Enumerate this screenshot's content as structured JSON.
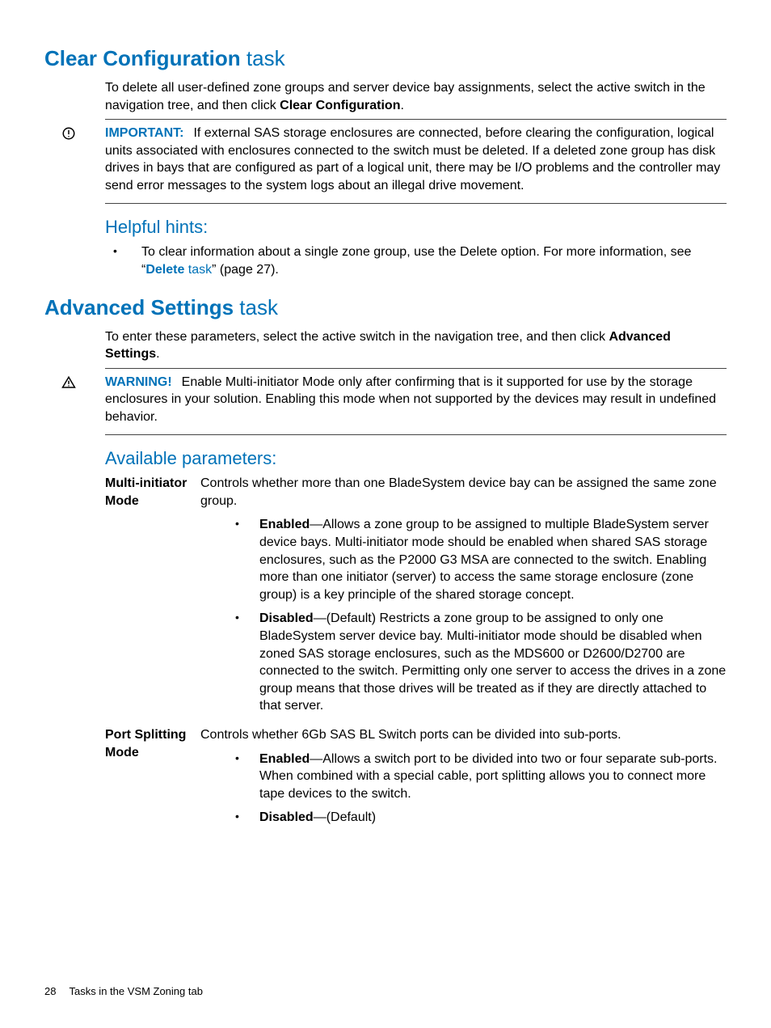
{
  "section1": {
    "title_bold": "Clear Configuration",
    "title_rest": " task",
    "intro_a": "To delete all user-defined zone groups and server device bay assignments, select the active switch in the navigation tree, and then click ",
    "intro_b_bold": "Clear Configuration",
    "intro_c": ".",
    "important_label": "IMPORTANT:",
    "important_body": "If external SAS storage enclosures are connected, before clearing the configuration, logical units associated with enclosures connected to the switch must be deleted. If a deleted zone group has disk drives in bays that are configured as part of a logical unit, there may be I/O problems and the controller may send error messages to the system logs about an illegal drive movement.",
    "hints_heading": "Helpful hints:",
    "hint1_a": "To clear information about a single zone group, use the Delete option. For more information, see “",
    "hint1_link_bold": "Delete",
    "hint1_link_rest": " task",
    "hint1_b": "” (page 27)."
  },
  "section2": {
    "title_bold": "Advanced Settings",
    "title_rest": " task",
    "intro_a": "To enter these parameters, select the active switch in the navigation tree, and then click ",
    "intro_b_bold": "Advanced Settings",
    "intro_c": ".",
    "warning_label": "WARNING!",
    "warning_body": "Enable Multi-initiator Mode only after confirming that is it supported for use by the storage enclosures in your solution. Enabling this mode when not supported by the devices may result in undefined behavior.",
    "params_heading": "Available parameters:",
    "param1_term": "Multi-initiator Mode",
    "param1_desc": "Controls whether more than one BladeSystem device bay can be assigned the same zone group.",
    "param1_enabled_label": "Enabled",
    "param1_enabled_body": "—Allows a zone group to be assigned to multiple BladeSystem server device bays. Multi-initiator mode should be enabled when shared SAS storage enclosures, such as the P2000 G3 MSA are connected to the switch. Enabling more than one initiator (server) to access the same storage enclosure (zone group) is a key principle of the shared storage concept.",
    "param1_disabled_label": "Disabled",
    "param1_disabled_body": "—(Default) Restricts a zone group to be assigned to only one BladeSystem server device bay. Multi-initiator mode should be disabled when zoned SAS storage enclosures, such as the MDS600 or D2600/D2700 are connected to the switch. Permitting only one server to access the drives in a zone group means that those drives will be treated as if they are directly attached to that server.",
    "param2_term": "Port Splitting Mode",
    "param2_desc": "Controls whether 6Gb SAS BL Switch ports can be divided into sub-ports.",
    "param2_enabled_label": "Enabled",
    "param2_enabled_body": "—Allows a switch port to be divided into two or four separate sub-ports. When combined with a special cable, port splitting allows you to connect more tape devices to the switch.",
    "param2_disabled_label": "Disabled",
    "param2_disabled_body": "—(Default)"
  },
  "footer": {
    "pagenum": "28",
    "chapter": "Tasks in the VSM Zoning tab"
  }
}
